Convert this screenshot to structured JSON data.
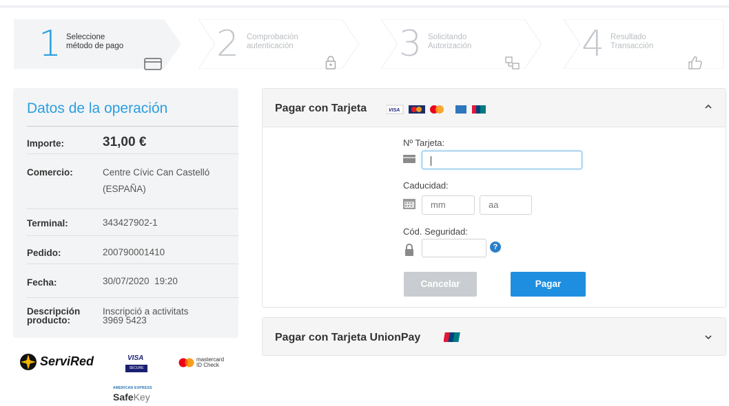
{
  "steps": [
    {
      "number": "1",
      "line1": "Seleccione",
      "line2": "método de pago",
      "icon": "credit-card-icon",
      "active": true
    },
    {
      "number": "2",
      "line1": "Comprobación",
      "line2": "autenticación",
      "icon": "lock-icon",
      "active": false
    },
    {
      "number": "3",
      "line1": "Solicitando",
      "line2": "Autorización",
      "icon": "authorization-icon",
      "active": false
    },
    {
      "number": "4",
      "line1": "Resultado",
      "line2": "Transacción",
      "icon": "thumbs-up-icon",
      "active": false
    }
  ],
  "operation": {
    "title": "Datos de la operación",
    "rows": [
      {
        "label": "Importe:",
        "value": "31,00 €"
      },
      {
        "label": "Comercio:",
        "value": "Centre Cívic Can Castelló",
        "value2": "(ESPAÑA)"
      },
      {
        "label": "Terminal:",
        "value": "343427902-1"
      },
      {
        "label": "Pedido:",
        "value": "200790001410"
      },
      {
        "label": "Fecha:",
        "value": "30/07/2020  19:20"
      },
      {
        "label": "Descripción",
        "label2": "producto:",
        "value": "Inscripció a activitats",
        "value2": "3969 5423"
      }
    ]
  },
  "logos": {
    "servired": "ServiRed",
    "visa": "VISA",
    "visa_secure": "SECURE",
    "mastercard": "mastercard",
    "mastercard_sub": "ID Check",
    "amex_small": "AMERICAN EXPRESS",
    "safekey_bold": "Safe",
    "safekey_light": "Key"
  },
  "card_panel": {
    "title": "Pagar con Tarjeta",
    "card_label": "Nº Tarjeta:",
    "card_value": "",
    "expiry_label": "Caducidad:",
    "month_placeholder": "mm",
    "year_placeholder": "aa",
    "cvv_label": "Cód. Seguridad:",
    "cvv_value": "",
    "help_icon_text": "?",
    "cancel_label": "Cancelar",
    "pay_label": "Pagar",
    "brand_logos": [
      "visa-logo",
      "maestro-logo",
      "mastercard-logo",
      "amex-logo",
      "unionpay-logo"
    ]
  },
  "unionpay_panel": {
    "title": "Pagar con Tarjeta UnionPay"
  },
  "colors": {
    "accent": "#2a9ee0",
    "pay_button": "#1e8fe0",
    "cancel_button": "#c9ccd0"
  }
}
